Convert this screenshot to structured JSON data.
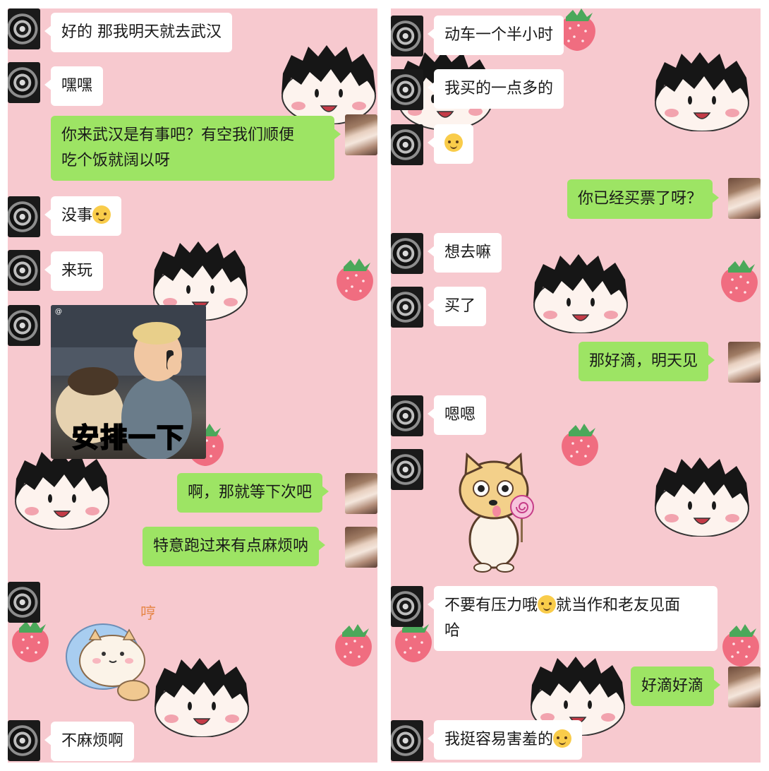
{
  "left_panel": {
    "messages": [
      {
        "from": "other",
        "text": "好的  那我明天就去武汉"
      },
      {
        "from": "other",
        "text": "嘿嘿"
      },
      {
        "from": "me",
        "lines": [
          "你来武汉是有事吧？有空我们顺便",
          "吃个饭就阔以呀"
        ]
      },
      {
        "from": "other",
        "text": "没事",
        "emoji": "smiling-face-emoji"
      },
      {
        "from": "other",
        "text": "来玩"
      },
      {
        "from": "other",
        "type": "image",
        "caption": "安排一下"
      },
      {
        "from": "me",
        "text": "啊，那就等下次吧"
      },
      {
        "from": "me",
        "text": "特意跑过来有点麻烦呐"
      },
      {
        "from": "other",
        "type": "sticker",
        "sticker": "pillow-dog-sticker",
        "sticker_text": "哼"
      },
      {
        "from": "other",
        "text": "不麻烦啊"
      }
    ]
  },
  "right_panel": {
    "messages": [
      {
        "from": "other",
        "text": "动车一个半小时"
      },
      {
        "from": "other",
        "text": "我买的一点多的"
      },
      {
        "from": "other",
        "type": "emoji-only",
        "emoji": "smiling-face-emoji"
      },
      {
        "from": "me",
        "text": "你已经买票了呀？"
      },
      {
        "from": "other",
        "text": "想去嘛"
      },
      {
        "from": "other",
        "text": "买了"
      },
      {
        "from": "me",
        "text": "那好滴，明天见"
      },
      {
        "from": "other",
        "text": "嗯嗯"
      },
      {
        "from": "other",
        "type": "sticker",
        "sticker": "lollipop-dog-sticker"
      },
      {
        "from": "other",
        "lines": [
          "不要有压力哦",
          "就当作和老友见面",
          "哈"
        ],
        "emoji": "smiling-face-emoji"
      },
      {
        "from": "me",
        "text": "好滴好滴"
      },
      {
        "from": "other",
        "text": "我挺容易害羞的",
        "emoji": "laughing-tears-emoji"
      }
    ]
  },
  "colors": {
    "background": "#f7c9cf",
    "bubble_in": "#ffffff",
    "bubble_out": "#9de464"
  }
}
